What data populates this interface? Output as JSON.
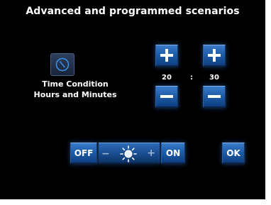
{
  "header": {
    "title": "Advanced and programmed scenarios"
  },
  "condition": {
    "icon": "clock-icon",
    "label_line1": "Time Condition",
    "label_line2": "Hours and Minutes"
  },
  "time": {
    "hours": "20",
    "separator": ":",
    "minutes": "30"
  },
  "controls": {
    "off_label": "OFF",
    "on_label": "ON",
    "ok_label": "OK",
    "dimmer_minus": "−",
    "dimmer_plus": "+",
    "dimmer_icon": "sun-icon"
  },
  "colors": {
    "background": "#000000",
    "button_blue": "#1f5eaa",
    "text": "#ffffff"
  }
}
